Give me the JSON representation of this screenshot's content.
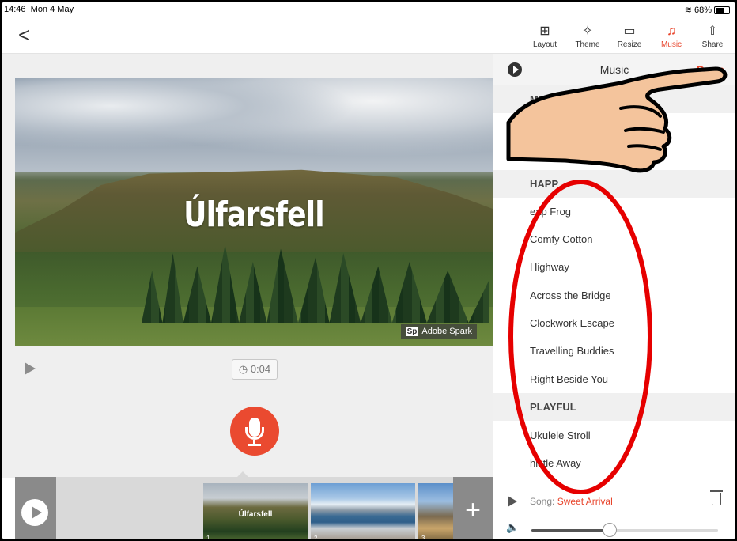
{
  "status_bar": {
    "time": "14:46",
    "date": "Mon 4 May",
    "battery": "68%",
    "battery_level": 0.68
  },
  "toolbar": {
    "back_label": "<",
    "tools": [
      {
        "label": "Layout",
        "icon": "layout-icon",
        "glyph": "⊞"
      },
      {
        "label": "Theme",
        "icon": "theme-icon",
        "glyph": "✧"
      },
      {
        "label": "Resize",
        "icon": "resize-icon",
        "glyph": "▭"
      },
      {
        "label": "Music",
        "icon": "music-icon",
        "glyph": "♫",
        "active": true
      },
      {
        "label": "Share",
        "icon": "share-icon",
        "glyph": "⇧"
      }
    ],
    "accent_color": "#e8452c"
  },
  "slide": {
    "title": "Úlfarsfell",
    "watermark_logo": "Sp",
    "watermark": "Adobe Spark"
  },
  "preview": {
    "duration": "0:04"
  },
  "filmstrip": {
    "thumbs": [
      {
        "number": "1",
        "title": "Úlfarsfell"
      },
      {
        "number": "2",
        "title": ""
      },
      {
        "number": "3",
        "title": ""
      }
    ],
    "add_label": "+"
  },
  "music_panel": {
    "title": "Music",
    "done_label": "Done",
    "sections": [
      {
        "title": "MY",
        "songs": [
          "ne"
        ]
      },
      {
        "title": "HAPP",
        "songs": [
          "eap Frog",
          "Comfy Cotton",
          "Highway",
          "Across the Bridge",
          "Clockwork Escape",
          "Travelling Buddies",
          "Right Beside You"
        ]
      },
      {
        "title": "PLAYFUL",
        "songs": [
          "Ukulele Stroll",
          "histle Away"
        ]
      }
    ],
    "footer": {
      "song_prefix": "Song:",
      "song_name": "Sweet Arrival",
      "volume": 0.42
    }
  }
}
